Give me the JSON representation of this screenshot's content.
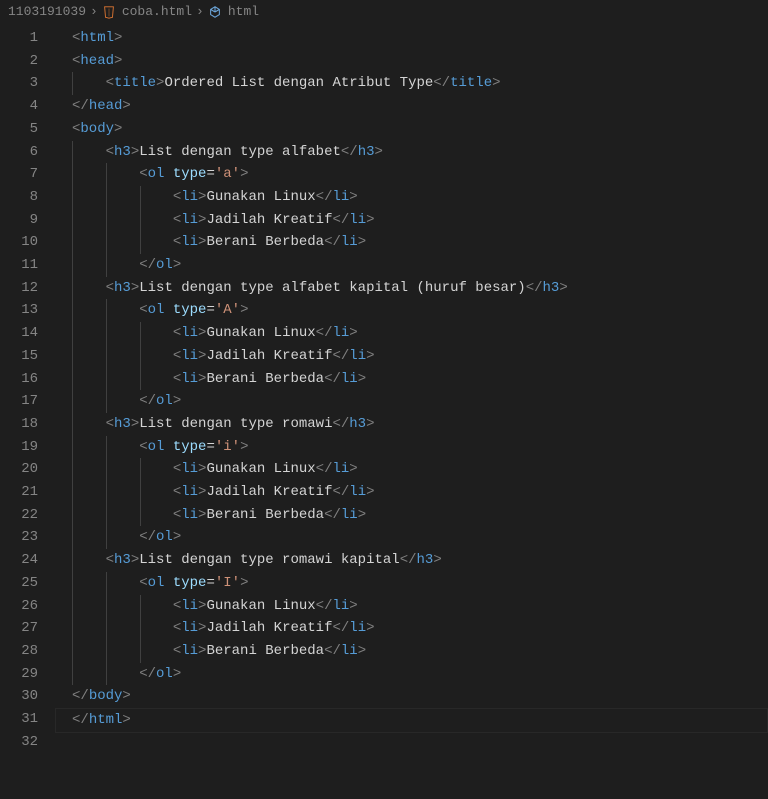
{
  "breadcrumb": {
    "folder": "1103191039",
    "file": "coba.html",
    "symbol": "html"
  },
  "lines": [
    {
      "n": 1,
      "indent": 0,
      "tokens": [
        [
          "b",
          "<"
        ],
        [
          "t",
          "html"
        ],
        [
          "b",
          ">"
        ]
      ]
    },
    {
      "n": 2,
      "indent": 0,
      "tokens": [
        [
          "b",
          "<"
        ],
        [
          "t",
          "head"
        ],
        [
          "b",
          ">"
        ]
      ]
    },
    {
      "n": 3,
      "indent": 1,
      "tokens": [
        [
          "b",
          "<"
        ],
        [
          "t",
          "title"
        ],
        [
          "b",
          ">"
        ],
        [
          "x",
          "Ordered List dengan Atribut Type"
        ],
        [
          "b",
          "</"
        ],
        [
          "t",
          "title"
        ],
        [
          "b",
          ">"
        ]
      ]
    },
    {
      "n": 4,
      "indent": 0,
      "tokens": [
        [
          "b",
          "</"
        ],
        [
          "t",
          "head"
        ],
        [
          "b",
          ">"
        ]
      ]
    },
    {
      "n": 5,
      "indent": 0,
      "tokens": []
    },
    {
      "n": 6,
      "indent": 0,
      "tokens": [
        [
          "b",
          "<"
        ],
        [
          "t",
          "body"
        ],
        [
          "b",
          ">"
        ]
      ]
    },
    {
      "n": 7,
      "indent": 1,
      "tokens": [
        [
          "b",
          "<"
        ],
        [
          "t",
          "h3"
        ],
        [
          "b",
          ">"
        ],
        [
          "x",
          "List dengan type alfabet"
        ],
        [
          "b",
          "</"
        ],
        [
          "t",
          "h3"
        ],
        [
          "b",
          ">"
        ]
      ]
    },
    {
      "n": 8,
      "indent": 2,
      "tokens": [
        [
          "b",
          "<"
        ],
        [
          "t",
          "ol"
        ],
        [
          "x",
          " "
        ],
        [
          "a",
          "type"
        ],
        [
          "e",
          "="
        ],
        [
          "s",
          "'a'"
        ],
        [
          "b",
          ">"
        ]
      ]
    },
    {
      "n": 9,
      "indent": 3,
      "tokens": [
        [
          "b",
          "<"
        ],
        [
          "t",
          "li"
        ],
        [
          "b",
          ">"
        ],
        [
          "x",
          "Gunakan Linux"
        ],
        [
          "b",
          "</"
        ],
        [
          "t",
          "li"
        ],
        [
          "b",
          ">"
        ]
      ]
    },
    {
      "n": 10,
      "indent": 3,
      "tokens": [
        [
          "b",
          "<"
        ],
        [
          "t",
          "li"
        ],
        [
          "b",
          ">"
        ],
        [
          "x",
          "Jadilah Kreatif"
        ],
        [
          "b",
          "</"
        ],
        [
          "t",
          "li"
        ],
        [
          "b",
          ">"
        ]
      ]
    },
    {
      "n": 11,
      "indent": 3,
      "tokens": [
        [
          "b",
          "<"
        ],
        [
          "t",
          "li"
        ],
        [
          "b",
          ">"
        ],
        [
          "x",
          "Berani Berbeda"
        ],
        [
          "b",
          "</"
        ],
        [
          "t",
          "li"
        ],
        [
          "b",
          ">"
        ]
      ]
    },
    {
      "n": 12,
      "indent": 2,
      "tokens": [
        [
          "b",
          "</"
        ],
        [
          "t",
          "ol"
        ],
        [
          "b",
          ">"
        ]
      ]
    },
    {
      "n": 13,
      "indent": 1,
      "tokens": [
        [
          "b",
          "<"
        ],
        [
          "t",
          "h3"
        ],
        [
          "b",
          ">"
        ],
        [
          "x",
          "List dengan type alfabet kapital (huruf besar)"
        ],
        [
          "b",
          "</"
        ],
        [
          "t",
          "h3"
        ],
        [
          "b",
          ">"
        ]
      ]
    },
    {
      "n": 14,
      "indent": 2,
      "tokens": [
        [
          "b",
          "<"
        ],
        [
          "t",
          "ol"
        ],
        [
          "x",
          " "
        ],
        [
          "a",
          "type"
        ],
        [
          "e",
          "="
        ],
        [
          "s",
          "'A'"
        ],
        [
          "b",
          ">"
        ]
      ]
    },
    {
      "n": 15,
      "indent": 3,
      "tokens": [
        [
          "b",
          "<"
        ],
        [
          "t",
          "li"
        ],
        [
          "b",
          ">"
        ],
        [
          "x",
          "Gunakan Linux"
        ],
        [
          "b",
          "</"
        ],
        [
          "t",
          "li"
        ],
        [
          "b",
          ">"
        ]
      ]
    },
    {
      "n": 16,
      "indent": 3,
      "tokens": [
        [
          "b",
          "<"
        ],
        [
          "t",
          "li"
        ],
        [
          "b",
          ">"
        ],
        [
          "x",
          "Jadilah Kreatif"
        ],
        [
          "b",
          "</"
        ],
        [
          "t",
          "li"
        ],
        [
          "b",
          ">"
        ]
      ]
    },
    {
      "n": 17,
      "indent": 3,
      "tokens": [
        [
          "b",
          "<"
        ],
        [
          "t",
          "li"
        ],
        [
          "b",
          ">"
        ],
        [
          "x",
          "Berani Berbeda"
        ],
        [
          "b",
          "</"
        ],
        [
          "t",
          "li"
        ],
        [
          "b",
          ">"
        ]
      ]
    },
    {
      "n": 18,
      "indent": 2,
      "tokens": [
        [
          "b",
          "</"
        ],
        [
          "t",
          "ol"
        ],
        [
          "b",
          ">"
        ]
      ]
    },
    {
      "n": 19,
      "indent": 1,
      "tokens": [
        [
          "b",
          "<"
        ],
        [
          "t",
          "h3"
        ],
        [
          "b",
          ">"
        ],
        [
          "x",
          "List dengan type romawi"
        ],
        [
          "b",
          "</"
        ],
        [
          "t",
          "h3"
        ],
        [
          "b",
          ">"
        ]
      ]
    },
    {
      "n": 20,
      "indent": 2,
      "tokens": [
        [
          "b",
          "<"
        ],
        [
          "t",
          "ol"
        ],
        [
          "x",
          " "
        ],
        [
          "a",
          "type"
        ],
        [
          "e",
          "="
        ],
        [
          "s",
          "'i'"
        ],
        [
          "b",
          ">"
        ]
      ]
    },
    {
      "n": 21,
      "indent": 3,
      "tokens": [
        [
          "b",
          "<"
        ],
        [
          "t",
          "li"
        ],
        [
          "b",
          ">"
        ],
        [
          "x",
          "Gunakan Linux"
        ],
        [
          "b",
          "</"
        ],
        [
          "t",
          "li"
        ],
        [
          "b",
          ">"
        ]
      ]
    },
    {
      "n": 22,
      "indent": 3,
      "tokens": [
        [
          "b",
          "<"
        ],
        [
          "t",
          "li"
        ],
        [
          "b",
          ">"
        ],
        [
          "x",
          "Jadilah Kreatif"
        ],
        [
          "b",
          "</"
        ],
        [
          "t",
          "li"
        ],
        [
          "b",
          ">"
        ]
      ]
    },
    {
      "n": 23,
      "indent": 3,
      "tokens": [
        [
          "b",
          "<"
        ],
        [
          "t",
          "li"
        ],
        [
          "b",
          ">"
        ],
        [
          "x",
          "Berani Berbeda"
        ],
        [
          "b",
          "</"
        ],
        [
          "t",
          "li"
        ],
        [
          "b",
          ">"
        ]
      ]
    },
    {
      "n": 24,
      "indent": 2,
      "tokens": [
        [
          "b",
          "</"
        ],
        [
          "t",
          "ol"
        ],
        [
          "b",
          ">"
        ]
      ]
    },
    {
      "n": 25,
      "indent": 1,
      "tokens": [
        [
          "b",
          "<"
        ],
        [
          "t",
          "h3"
        ],
        [
          "b",
          ">"
        ],
        [
          "x",
          "List dengan type romawi kapital"
        ],
        [
          "b",
          "</"
        ],
        [
          "t",
          "h3"
        ],
        [
          "b",
          ">"
        ]
      ]
    },
    {
      "n": 26,
      "indent": 2,
      "tokens": [
        [
          "b",
          "<"
        ],
        [
          "t",
          "ol"
        ],
        [
          "x",
          " "
        ],
        [
          "a",
          "type"
        ],
        [
          "e",
          "="
        ],
        [
          "s",
          "'I'"
        ],
        [
          "b",
          ">"
        ]
      ]
    },
    {
      "n": 27,
      "indent": 3,
      "tokens": [
        [
          "b",
          "<"
        ],
        [
          "t",
          "li"
        ],
        [
          "b",
          ">"
        ],
        [
          "x",
          "Gunakan Linux"
        ],
        [
          "b",
          "</"
        ],
        [
          "t",
          "li"
        ],
        [
          "b",
          ">"
        ]
      ]
    },
    {
      "n": 28,
      "indent": 3,
      "tokens": [
        [
          "b",
          "<"
        ],
        [
          "t",
          "li"
        ],
        [
          "b",
          ">"
        ],
        [
          "x",
          "Jadilah Kreatif"
        ],
        [
          "b",
          "</"
        ],
        [
          "t",
          "li"
        ],
        [
          "b",
          ">"
        ]
      ]
    },
    {
      "n": 29,
      "indent": 3,
      "tokens": [
        [
          "b",
          "<"
        ],
        [
          "t",
          "li"
        ],
        [
          "b",
          ">"
        ],
        [
          "x",
          "Berani Berbeda"
        ],
        [
          "b",
          "</"
        ],
        [
          "t",
          "li"
        ],
        [
          "b",
          ">"
        ]
      ]
    },
    {
      "n": 30,
      "indent": 2,
      "tokens": [
        [
          "b",
          "</"
        ],
        [
          "t",
          "ol"
        ],
        [
          "b",
          ">"
        ]
      ]
    },
    {
      "n": 31,
      "indent": 0,
      "tokens": [
        [
          "b",
          "</"
        ],
        [
          "t",
          "body"
        ],
        [
          "b",
          ">"
        ]
      ]
    },
    {
      "n": 32,
      "indent": 0,
      "tokens": [
        [
          "b",
          "</"
        ],
        [
          "t",
          "html"
        ],
        [
          "b",
          ">"
        ]
      ],
      "cursor": true
    }
  ]
}
